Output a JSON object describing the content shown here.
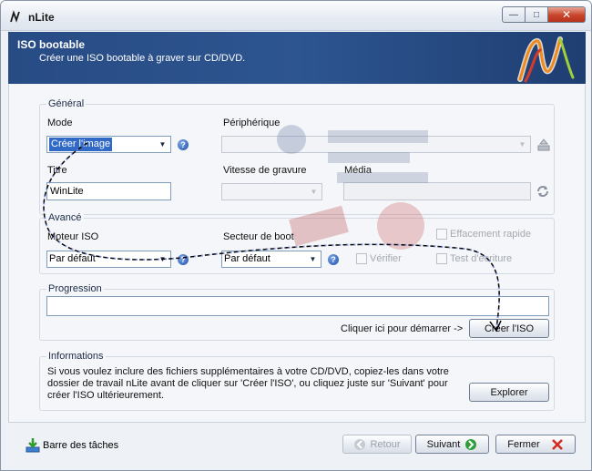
{
  "window": {
    "title": "nLite",
    "minimize": "—",
    "maximize": "□",
    "close": "✕"
  },
  "banner": {
    "title": "ISO bootable",
    "subtitle": "Créer une ISO bootable à graver sur CD/DVD."
  },
  "general": {
    "title": "Général",
    "mode_label": "Mode",
    "mode_value": "Créer l'image",
    "device_label": "Périphérique",
    "device_value": "",
    "title_label": "Titre",
    "title_value": "WinLite",
    "speed_label": "Vitesse de gravure",
    "speed_value": "",
    "media_label": "Média",
    "media_value": ""
  },
  "advanced": {
    "title": "Avancé",
    "engine_label": "Moteur ISO",
    "engine_value": "Par défaut",
    "boot_label": "Secteur de boot",
    "boot_value": "Par défaut",
    "quick_erase_label": "Effacement rapide",
    "verify_label": "Vérifier",
    "test_write_label": "Test d'écriture"
  },
  "progress": {
    "title": "Progression",
    "value": 0,
    "hint": "Cliquer ici pour démarrer ->",
    "create_iso_label": "Créer l'ISO"
  },
  "info": {
    "title": "Informations",
    "lines": [
      "Si vous voulez inclure des fichiers supplémentaires à votre CD/DVD, copiez-les dans votre",
      "dossier de travail nLite avant de cliquer sur 'Créer l'ISO', ou cliquez juste sur 'Suivant' pour",
      "créer l'ISO ultérieurement."
    ],
    "explore_label": "Explorer"
  },
  "footer": {
    "taskbar_label": "Barre des tâches",
    "back_label": "Retour",
    "next_label": "Suivant",
    "close_label": "Fermer"
  }
}
